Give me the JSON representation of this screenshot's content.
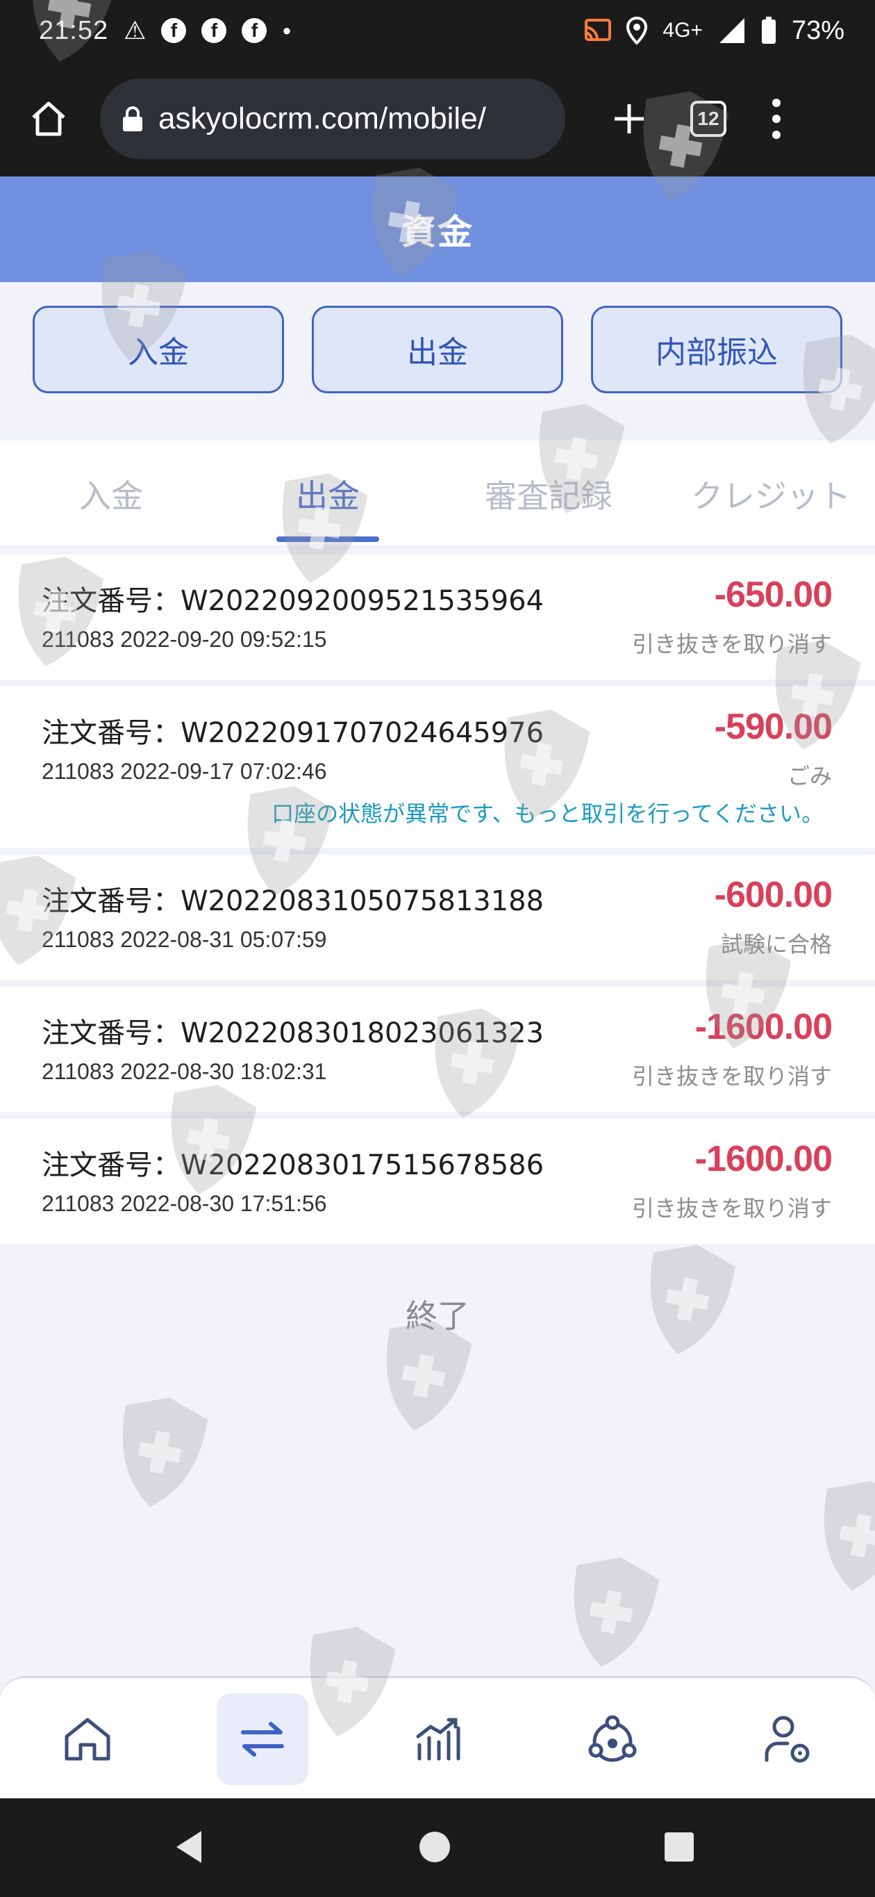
{
  "status_bar": {
    "time": "21:52",
    "notification_icons": [
      "warning-icon",
      "facebook-icon",
      "facebook-icon",
      "facebook-icon",
      "dot-icon"
    ],
    "network": "4G+",
    "battery": "73%"
  },
  "browser": {
    "url": "askyolocrm.com/mobile/",
    "tab_count": "12"
  },
  "header": {
    "title": "資金"
  },
  "actions": [
    {
      "label": "入金"
    },
    {
      "label": "出金"
    },
    {
      "label": "内部振込"
    }
  ],
  "tabs": [
    {
      "label": "入金"
    },
    {
      "label": "出金"
    },
    {
      "label": "審査記録"
    },
    {
      "label": "クレジット"
    }
  ],
  "active_tab": "出金",
  "records": [
    {
      "order": "注文番号：W2022092009521535964",
      "meta": "211083 2022-09-20 09:52:15",
      "amount": "-650.00",
      "status": "引き抜きを取り消す"
    },
    {
      "order": "注文番号：W2022091707024645976",
      "meta": "211083 2022-09-17 07:02:46",
      "amount": "-590.00",
      "status": "ごみ",
      "note": "口座の状態が異常です、もっと取引を行ってください。"
    },
    {
      "order": "注文番号：W2022083105075813188",
      "meta": "211083 2022-08-31 05:07:59",
      "amount": "-600.00",
      "status": "試験に合格"
    },
    {
      "order": "注文番号：W2022083018023061323",
      "meta": "211083 2022-08-30 18:02:31",
      "amount": "-1600.00",
      "status": "引き抜きを取り消す"
    },
    {
      "order": "注文番号：W2022083017515678586",
      "meta": "211083 2022-08-30 17:51:56",
      "amount": "-1600.00",
      "status": "引き抜きを取り消す"
    }
  ],
  "end_text": "終了",
  "bottom_nav": [
    "home-icon",
    "transfer-icon",
    "chart-icon",
    "community-icon",
    "user-settings-icon"
  ],
  "colors": {
    "header": "#7290e0",
    "accent": "#4a6fd0",
    "amount": "#d9405a",
    "note": "#1a9bc0"
  }
}
